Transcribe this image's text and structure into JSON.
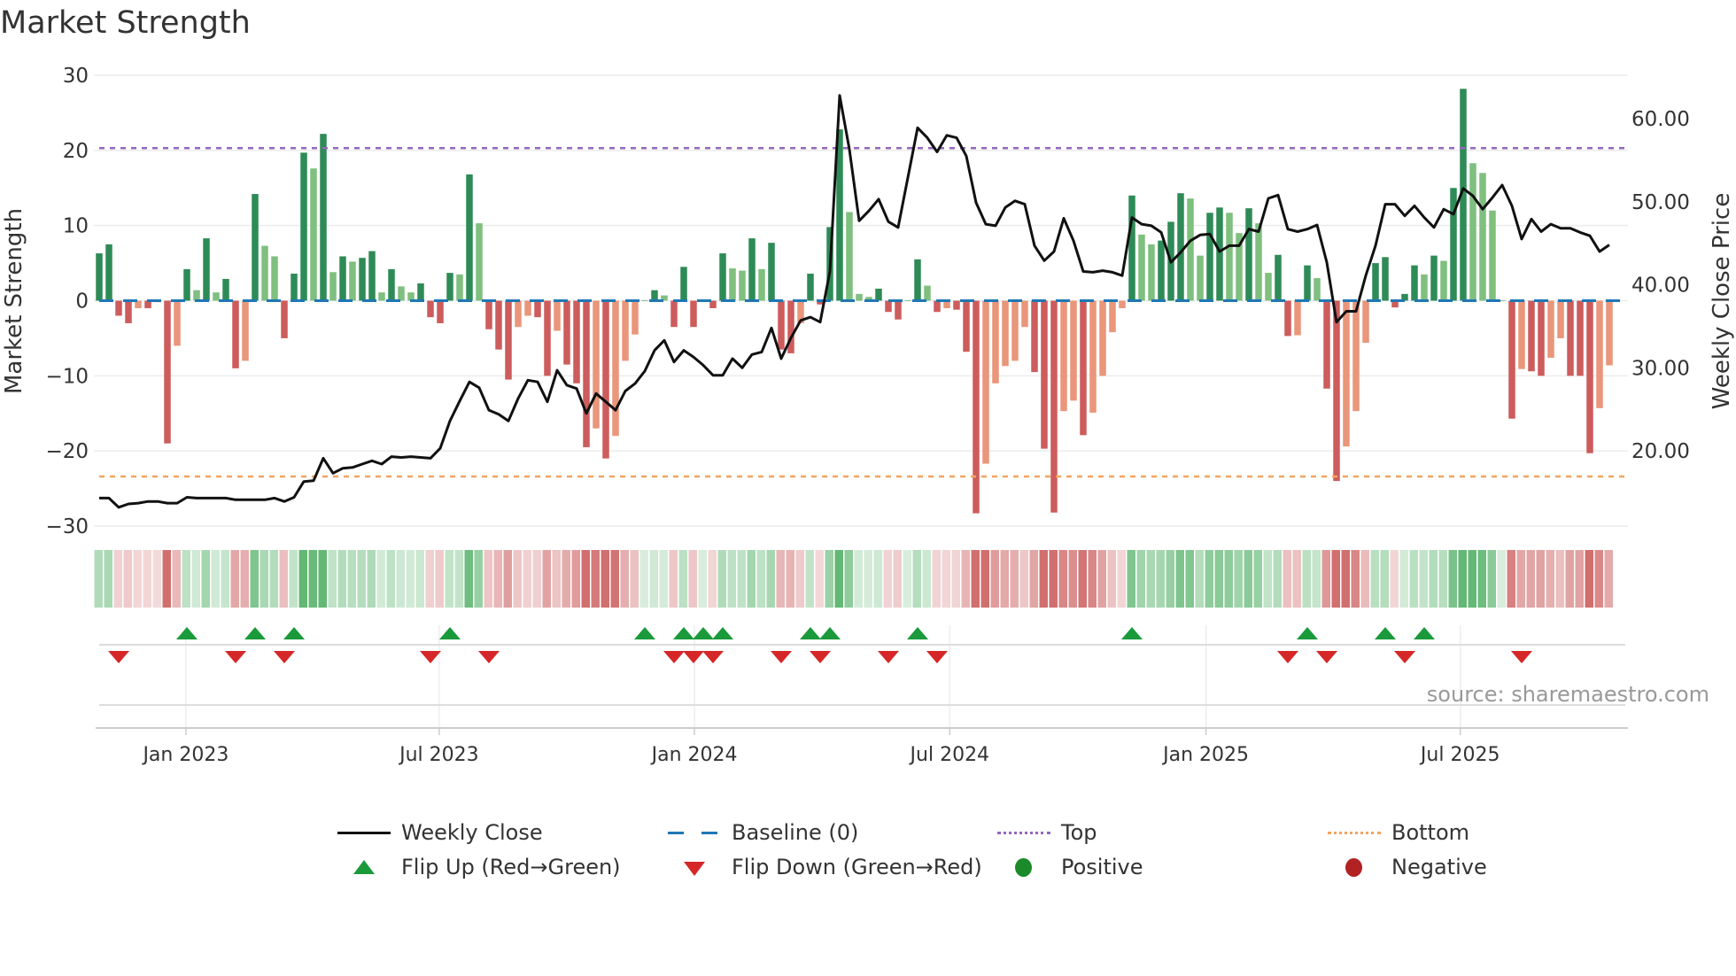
{
  "title": "Market Strength",
  "source": "source: sharemaestro.com",
  "colors": {
    "pos_strong": "#2e8b57",
    "pos_weak": "#7fbf7f",
    "neg_strong": "#cd5c5c",
    "neg_weak": "#e9967a",
    "close": "#111111",
    "baseline": "#1f77b4",
    "top": "#9467bd",
    "bottom": "#f4a460",
    "flip_up": "#1a9a3a",
    "flip_down": "#d62728",
    "positive": "#1a8a2a",
    "negative": "#b22222"
  },
  "chart_data": {
    "type": "bar+line",
    "title": "Market Strength",
    "ylabel": "Market Strength",
    "y2label": "Weekly Close Price",
    "ylim": [
      -30,
      30
    ],
    "y2lim": [
      11.9,
      66.3
    ],
    "yticks": [
      "30",
      "20",
      "10",
      "0",
      "−10",
      "−20",
      "−30"
    ],
    "ytick_values": [
      30,
      20,
      10,
      0,
      -10,
      -20,
      -30
    ],
    "y2ticks": [
      "60.00",
      "50.00",
      "40.00",
      "30.00",
      "20.00"
    ],
    "y2tick_values": [
      60,
      50,
      40,
      30,
      20
    ],
    "x_unit": "week index (weekly, ~Nov 2022 to Oct 2025)",
    "xticks": [
      {
        "label": "Jan 2023",
        "week": 8.9
      },
      {
        "label": "Jul 2023",
        "week": 34.9
      },
      {
        "label": "Jan 2024",
        "week": 61.1
      },
      {
        "label": "Jul 2024",
        "week": 87.3
      },
      {
        "label": "Jan 2025",
        "week": 113.6
      },
      {
        "label": "Jul 2025",
        "week": 139.7
      }
    ],
    "top_level": 20.3,
    "bottom_level": -23.4,
    "baseline": 0,
    "strength": [
      6.3,
      7.5,
      -2,
      -3,
      -1,
      -1,
      -0.2,
      -19,
      -6,
      4.2,
      1.4,
      8.3,
      1.1,
      2.9,
      -9,
      -8,
      14.2,
      7.3,
      5.9,
      -5,
      3.6,
      19.7,
      17.6,
      22.2,
      3.8,
      5.9,
      5.2,
      5.7,
      6.6,
      1.1,
      4.2,
      1.9,
      1.1,
      2.3,
      -2.2,
      -3,
      3.7,
      3.5,
      16.8,
      10.3,
      -3.8,
      -6.5,
      -10.5,
      -3.5,
      -2,
      -2.2,
      -10,
      -4,
      -8.5,
      -11,
      -19.5,
      -17,
      -21,
      -18,
      -8,
      -4.5,
      0,
      1.4,
      0.7,
      -3.5,
      4.5,
      -3.5,
      0,
      -1,
      6.3,
      4.3,
      4,
      8.3,
      4.2,
      7.7,
      -6.5,
      -7,
      -3,
      3.6,
      -0.5,
      9.8,
      22.8,
      11.8,
      0.9,
      0.5,
      1.6,
      -1.5,
      -2.5,
      0,
      5.5,
      2,
      -1.5,
      -1,
      -1.2,
      -6.8,
      -28.3,
      -21.7,
      -11,
      -8.7,
      -8,
      -3.5,
      -9.5,
      -19.7,
      -28.2,
      -14.7,
      -13.3,
      -17.9,
      -14.9,
      -10,
      -4.2,
      -1,
      14,
      8.8,
      7.5,
      8,
      10.5,
      14.3,
      13.6,
      6,
      11.7,
      12.4,
      11.7,
      9,
      12.3,
      10.3,
      3.7,
      6.1,
      -4.7,
      -4.6,
      4.7,
      3,
      -11.7,
      -24,
      -19.4,
      -14.7,
      -5.6,
      5,
      5.8,
      -0.9,
      0.9,
      4.7,
      3.5,
      6,
      5.3,
      15,
      28.2,
      18.3,
      17,
      12,
      0,
      -15.7,
      -9.1,
      -9.4,
      -10,
      -7.6,
      -5,
      -10,
      -10,
      -20.3,
      -14.3,
      -8.6
    ],
    "close": [
      14.3,
      14.3,
      13.2,
      13.6,
      13.7,
      13.9,
      13.9,
      13.7,
      13.7,
      14.4,
      14.3,
      14.3,
      14.3,
      14.3,
      14.1,
      14.1,
      14.1,
      14.1,
      14.3,
      13.9,
      14.4,
      16.3,
      16.4,
      19.1,
      17.3,
      17.9,
      18.0,
      18.4,
      18.8,
      18.4,
      19.3,
      19.2,
      19.3,
      19.2,
      19.1,
      20.3,
      23.6,
      26.0,
      28.3,
      27.6,
      24.9,
      24.4,
      23.6,
      26.3,
      28.5,
      28.3,
      25.9,
      29.7,
      27.9,
      27.5,
      24.5,
      26.9,
      25.9,
      24.9,
      27.2,
      28.1,
      29.6,
      32.1,
      33.3,
      30.7,
      32.1,
      31.3,
      30.3,
      29.1,
      29.1,
      31.1,
      30.0,
      31.6,
      31.9,
      34.8,
      31.1,
      33.6,
      35.7,
      36.1,
      35.5,
      41.6,
      62.8,
      56.3,
      47.7,
      48.9,
      50.3,
      47.6,
      46.9,
      52.9,
      58.9,
      57.7,
      56.0,
      58.0,
      57.7,
      55.5,
      49.9,
      47.3,
      47.1,
      49.3,
      50.1,
      49.7,
      44.7,
      42.9,
      44.0,
      48.0,
      45.3,
      41.6,
      41.5,
      41.7,
      41.5,
      41.1,
      48.1,
      47.3,
      47.1,
      46.3,
      42.7,
      43.9,
      45.3,
      46.0,
      46.1,
      44.0,
      44.7,
      44.7,
      46.7,
      46.4,
      50.4,
      50.8,
      46.7,
      46.4,
      46.7,
      47.2,
      42.7,
      35.5,
      36.8,
      36.8,
      41.1,
      44.7,
      49.7,
      49.7,
      48.3,
      49.5,
      48.1,
      46.9,
      49.1,
      48.5,
      51.6,
      50.7,
      49.1,
      50.5,
      52.0,
      49.5,
      45.5,
      47.9,
      46.4,
      47.3,
      46.8,
      46.8,
      46.3,
      45.9,
      44.0,
      44.8
    ],
    "flip_up_weeks": [
      9,
      16,
      20,
      36,
      56,
      60,
      62,
      64,
      73,
      75,
      84,
      106,
      124,
      132,
      136
    ],
    "flip_down_weeks": [
      2,
      14,
      19,
      34,
      40,
      59,
      61,
      63,
      70,
      74,
      81,
      86,
      122,
      126,
      134,
      146
    ],
    "legend_placement": "bottom",
    "legend": [
      {
        "label": "Weekly Close",
        "kind": "line"
      },
      {
        "label": "Baseline (0)",
        "kind": "dash"
      },
      {
        "label": "Top",
        "kind": "dot-top"
      },
      {
        "label": "Bottom",
        "kind": "dot-bottom"
      },
      {
        "label": "Flip Up (Red→Green)",
        "kind": "tri-up"
      },
      {
        "label": "Flip Down (Green→Red)",
        "kind": "tri-down"
      },
      {
        "label": "Positive",
        "kind": "dot-pos"
      },
      {
        "label": "Negative",
        "kind": "dot-neg"
      }
    ]
  }
}
